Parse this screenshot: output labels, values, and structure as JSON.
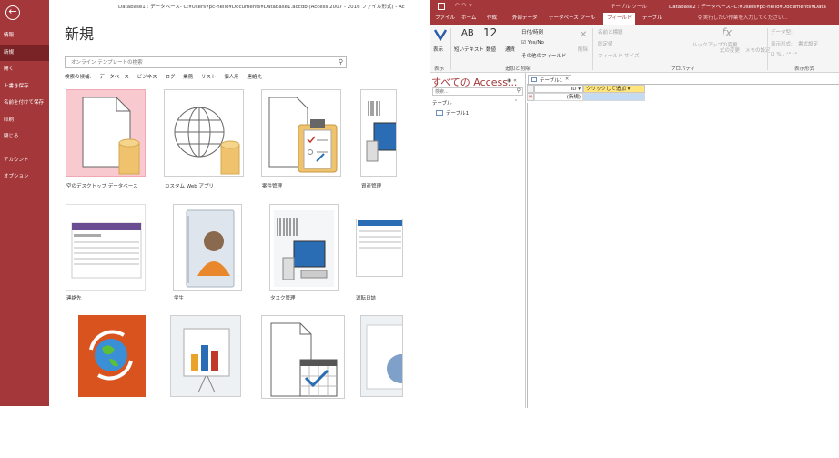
{
  "left_window": {
    "title": "Database1 : データベース- C:¥Users¥pc-hello¥Documents¥Database1.accdb (Access 2007 - 2016 ファイル形式) - Access",
    "backstage_nav": [
      {
        "label": "情報",
        "active": false
      },
      {
        "label": "新規",
        "active": true
      },
      {
        "label": "開く",
        "active": false
      },
      {
        "label": "上書き保存",
        "active": false
      },
      {
        "label": "名前を付けて保存",
        "active": false
      },
      {
        "label": "印刷",
        "active": false
      },
      {
        "label": "閉じる",
        "active": false
      },
      {
        "label": "アカウント",
        "active": false
      },
      {
        "label": "オプション",
        "active": false
      }
    ],
    "page_title": "新規",
    "search": {
      "placeholder": "オンライン テンプレートの検索"
    },
    "suggested": {
      "label": "検索の候補:",
      "items": [
        "データベース",
        "ビジネス",
        "ログ",
        "業務",
        "リスト",
        "個人用",
        "連絡先"
      ]
    },
    "templates": [
      {
        "label": "空のデスクトップ データベース",
        "icon": "blank-database-icon",
        "selected": true
      },
      {
        "label": "カスタム Web アプリ",
        "icon": "web-app-globe-icon",
        "selected": false
      },
      {
        "label": "案件管理",
        "icon": "clipboard-checklist-icon",
        "selected": false
      },
      {
        "label": "資産管理",
        "icon": "asset-barcode-computer-icon",
        "selected": false
      },
      {
        "label": "連絡先",
        "icon": "contacts-thumbnail-icon",
        "selected": false
      },
      {
        "label": "学生",
        "icon": "student-person-icon",
        "selected": false
      },
      {
        "label": "タスク管理",
        "icon": "task-barcode-computer-icon",
        "selected": false
      },
      {
        "label": "運転日誌",
        "icon": "log-thumbnail-icon",
        "selected": false
      },
      {
        "label": "",
        "icon": "globe-sync-icon",
        "selected": false
      },
      {
        "label": "",
        "icon": "presentation-chart-icon",
        "selected": false
      },
      {
        "label": "",
        "icon": "calendar-check-icon",
        "selected": false
      },
      {
        "label": "",
        "icon": "partial-template-icon",
        "selected": false
      }
    ]
  },
  "right_window": {
    "quick_access": "↶ ↷ ▾",
    "context_title": "テーブル ツール",
    "doc_title": "Database2 : データベース- C:¥Users¥pc-hello¥Documents¥Data",
    "tabs": [
      {
        "label": "ファイル",
        "active": false
      },
      {
        "label": "ホーム",
        "active": false
      },
      {
        "label": "作成",
        "active": false
      },
      {
        "label": "外部データ",
        "active": false
      },
      {
        "label": "データベース ツール",
        "active": false
      },
      {
        "label": "フィールド",
        "active": true
      },
      {
        "label": "テーブル",
        "active": false
      }
    ],
    "tell_me": "♀ 実行したい作業を入力してください...",
    "ribbon": {
      "view_label": "表示",
      "view_group": "表示",
      "ab_label": "AB",
      "num_label": "12",
      "short_text": "短いテキスト",
      "number_label": "数値",
      "currency_label": "通貨",
      "date_time": "日付/時刻",
      "yes_no": "Yes/No",
      "more_fields": "その他のフィールド",
      "delete_label": "削除",
      "add_delete_group": "追加と削除",
      "name_caption": "名前と標題",
      "default_value": "既定値",
      "field_size": "フィールド サイズ",
      "lookup_change": "ルックアップの変更",
      "expression": "式の変更",
      "memo_settings": "メモの設定",
      "properties_group": "プロパティ",
      "data_type": "データ型:",
      "format_label": "表示形式:",
      "format_value": "書式設定",
      "format_group": "表示形式"
    },
    "nav_pane": {
      "header": "すべての Access...",
      "search_placeholder": "検索...",
      "group": "テーブル",
      "items": [
        "テーブル1"
      ]
    },
    "document": {
      "tab_label": "テーブル1",
      "columns": [
        "ID",
        "クリックして追加"
      ],
      "new_row": "(新規)"
    }
  }
}
